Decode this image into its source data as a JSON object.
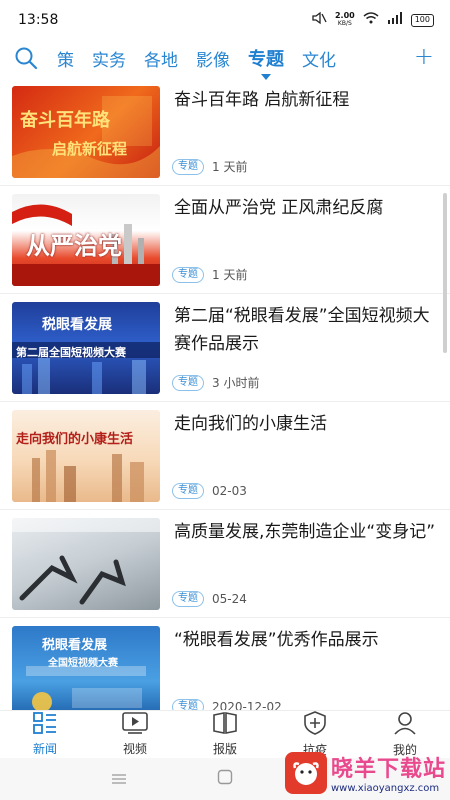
{
  "status_bar": {
    "time": "13:58",
    "net_speed": "2.00",
    "net_unit": "KB/S",
    "battery": "100"
  },
  "channels": [
    {
      "label": "策",
      "active": false
    },
    {
      "label": "实务",
      "active": false
    },
    {
      "label": "各地",
      "active": false
    },
    {
      "label": "影像",
      "active": false
    },
    {
      "label": "专题",
      "active": true
    },
    {
      "label": "文化",
      "active": false
    }
  ],
  "channel_add_label": "+",
  "news": [
    {
      "title": "奋斗百年路 启航新征程",
      "tag": "专题",
      "time": "1 天前",
      "thumb_caption_a": "奋斗百年路",
      "thumb_caption_b": "启航新征程"
    },
    {
      "title": "全面从严治党 正风肃纪反腐",
      "tag": "专题",
      "time": "1 天前",
      "thumb_caption_a": "从严治党"
    },
    {
      "title": "第二届“税眼看发展”全国短视频大赛作品展示",
      "tag": "专题",
      "time": "3 小时前",
      "thumb_caption_a": "税眼看发展",
      "thumb_caption_b": "第二届全国短视频大赛"
    },
    {
      "title": "走向我们的小康生活",
      "tag": "专题",
      "time": "02-03",
      "thumb_caption_a": "走向我们的小康生活"
    },
    {
      "title": "高质量发展,东莞制造企业“变身记”",
      "tag": "专题",
      "time": "05-24"
    },
    {
      "title": "“税眼看发展”优秀作品展示",
      "tag": "专题",
      "time": "2020-12-02",
      "thumb_caption_a": "税眼看发展",
      "thumb_caption_b": "全国短视频大赛"
    }
  ],
  "bottom_nav": [
    {
      "label": "新闻",
      "icon": "news-grid-icon",
      "active": true
    },
    {
      "label": "视频",
      "icon": "video-play-icon",
      "active": false
    },
    {
      "label": "报版",
      "icon": "newspaper-icon",
      "active": false
    },
    {
      "label": "抗疫",
      "icon": "shield-plus-icon",
      "active": false
    },
    {
      "label": "我的",
      "icon": "user-icon",
      "active": false
    }
  ],
  "watermark": {
    "title": "晓羊下载站",
    "url": "www.xiaoyangxz.com"
  },
  "colors": {
    "accent": "#1f7fd0",
    "tag_border": "#8ec1ea"
  }
}
